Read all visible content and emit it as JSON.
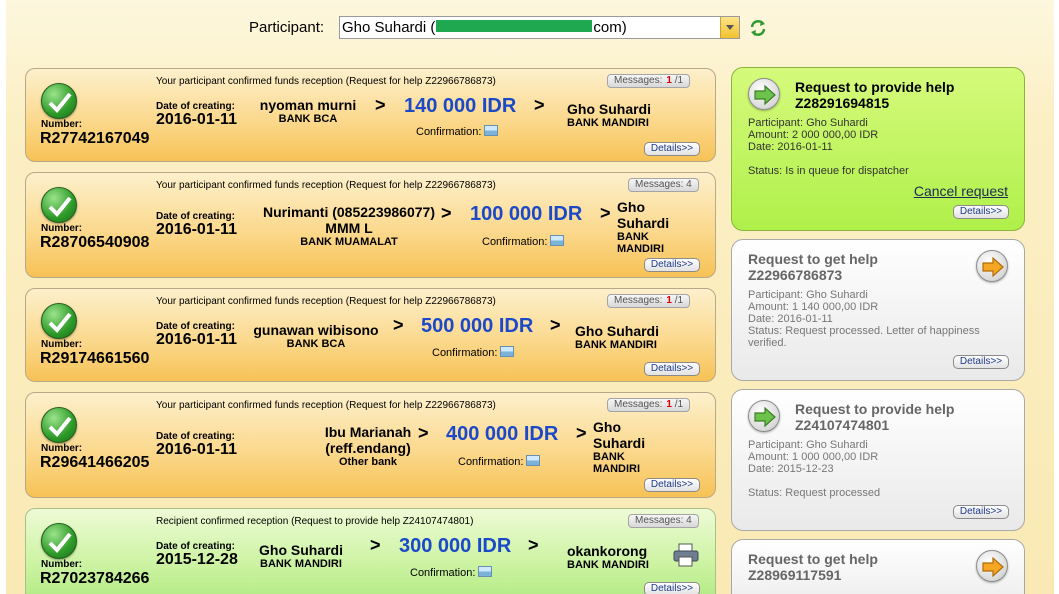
{
  "header": {
    "participant_label": "Participant:",
    "participant_name": "Gho Suhardi (",
    "participant_suffix": "com)"
  },
  "common": {
    "number_label": "Number:",
    "date_label": "Date of creating:",
    "confirmation_label": "Confirmation:",
    "details_label": "Details>>",
    "arrow": ">"
  },
  "cards": [
    {
      "status": "Your participant confirmed funds reception (Request for help Z22966786873)",
      "messages": "Messages:",
      "messages_unread": "1",
      "messages_total": "/1",
      "number": "R27742167049",
      "date": "2016-01-11",
      "sender": "nyoman murni",
      "sender_bank": "BANK BCA",
      "amount": "140 000 IDR",
      "receiver": "Gho Suhardi",
      "receiver_bank": "BANK MANDIRI"
    },
    {
      "status": "Your participant confirmed funds reception (Request for help Z22966786873)",
      "messages": "Messages: 4",
      "number": "R28706540908",
      "date": "2016-01-11",
      "sender": "Nurimanti (085223986077) MMM L",
      "sender_bank": "BANK MUAMALAT",
      "amount": "100 000 IDR",
      "receiver": "Gho Suhardi",
      "receiver_bank": "BANK MANDIRI"
    },
    {
      "status": "Your participant confirmed funds reception (Request for help Z22966786873)",
      "messages": "Messages:",
      "messages_unread": "1",
      "messages_total": "/1",
      "number": "R29174661560",
      "date": "2016-01-11",
      "sender": "gunawan wibisono",
      "sender_bank": "BANK BCA",
      "amount": "500 000 IDR",
      "receiver": "Gho Suhardi",
      "receiver_bank": "BANK MANDIRI"
    },
    {
      "status": "Your participant confirmed funds reception (Request for help Z22966786873)",
      "messages": "Messages:",
      "messages_unread": "1",
      "messages_total": "/1",
      "number": "R29641466205",
      "date": "2016-01-11",
      "sender": "Ibu Marianah (reff.endang)",
      "sender_bank": "Other bank",
      "amount": "400 000 IDR",
      "receiver": "Gho Suhardi",
      "receiver_bank": "BANK MANDIRI"
    },
    {
      "status": "Recipient confirmed reception (Request to provide help Z24107474801)",
      "messages": "Messages: 4",
      "number": "R27023784266",
      "date": "2015-12-28",
      "sender": "Gho Suhardi",
      "sender_bank": "BANK MANDIRI",
      "amount": "300 000 IDR",
      "receiver": "okankorong",
      "receiver_bank": "BANK MANDIRI"
    }
  ],
  "requests": [
    {
      "title": "Request to provide help",
      "id": "Z28291694815",
      "participant": "Participant: Gho Suhardi",
      "amount": "Amount: 2 000 000,00 IDR",
      "date": "Date: 2016-01-11",
      "status": "Status: Is in queue for dispatcher",
      "cancel": "Cancel request"
    },
    {
      "title": "Request to get help",
      "id": "Z22966786873",
      "participant": "Participant: Gho Suhardi",
      "amount": "Amount: 1 140 000,00 IDR",
      "date": "Date: 2016-01-11",
      "status": "Status: Request processed. Letter of happiness verified."
    },
    {
      "title": "Request to provide help",
      "id": "Z24107474801",
      "participant": "Participant: Gho Suhardi",
      "amount": "Amount: 1 000 000,00 IDR",
      "date": "Date: 2015-12-23",
      "status": "Status: Request processed"
    },
    {
      "title": "Request to get help",
      "id": "Z28969117591"
    }
  ],
  "colors": {
    "amount_blue": "#1b49c8",
    "check_green": "#2d9a28",
    "active_request_green": "#aff04a",
    "request_arrow_orange": "#f5a623"
  },
  "icons": {
    "refresh": "refresh-icon",
    "check": "check-icon",
    "image": "image-icon",
    "printer": "printer-icon",
    "arrow_right_green": "arrow-right-green-icon",
    "arrow_right_orange": "arrow-right-orange-icon"
  }
}
